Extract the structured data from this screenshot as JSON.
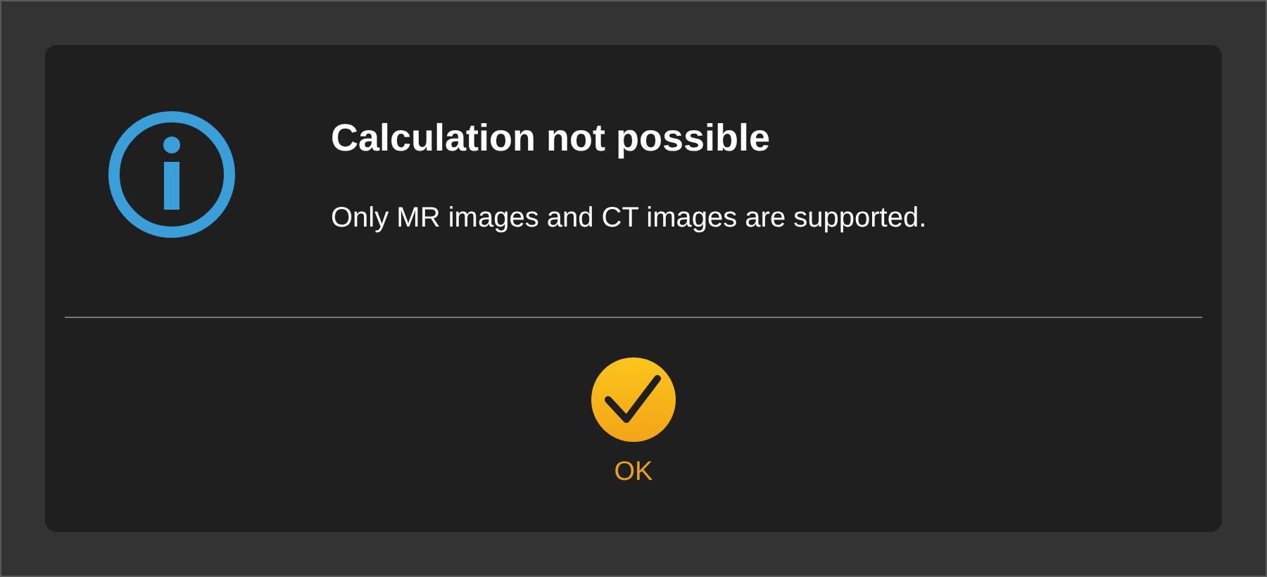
{
  "dialog": {
    "title": "Calculation not possible",
    "message": "Only MR images and CT images are supported.",
    "buttons": [
      {
        "label": "OK",
        "kind": "confirm"
      }
    ]
  }
}
